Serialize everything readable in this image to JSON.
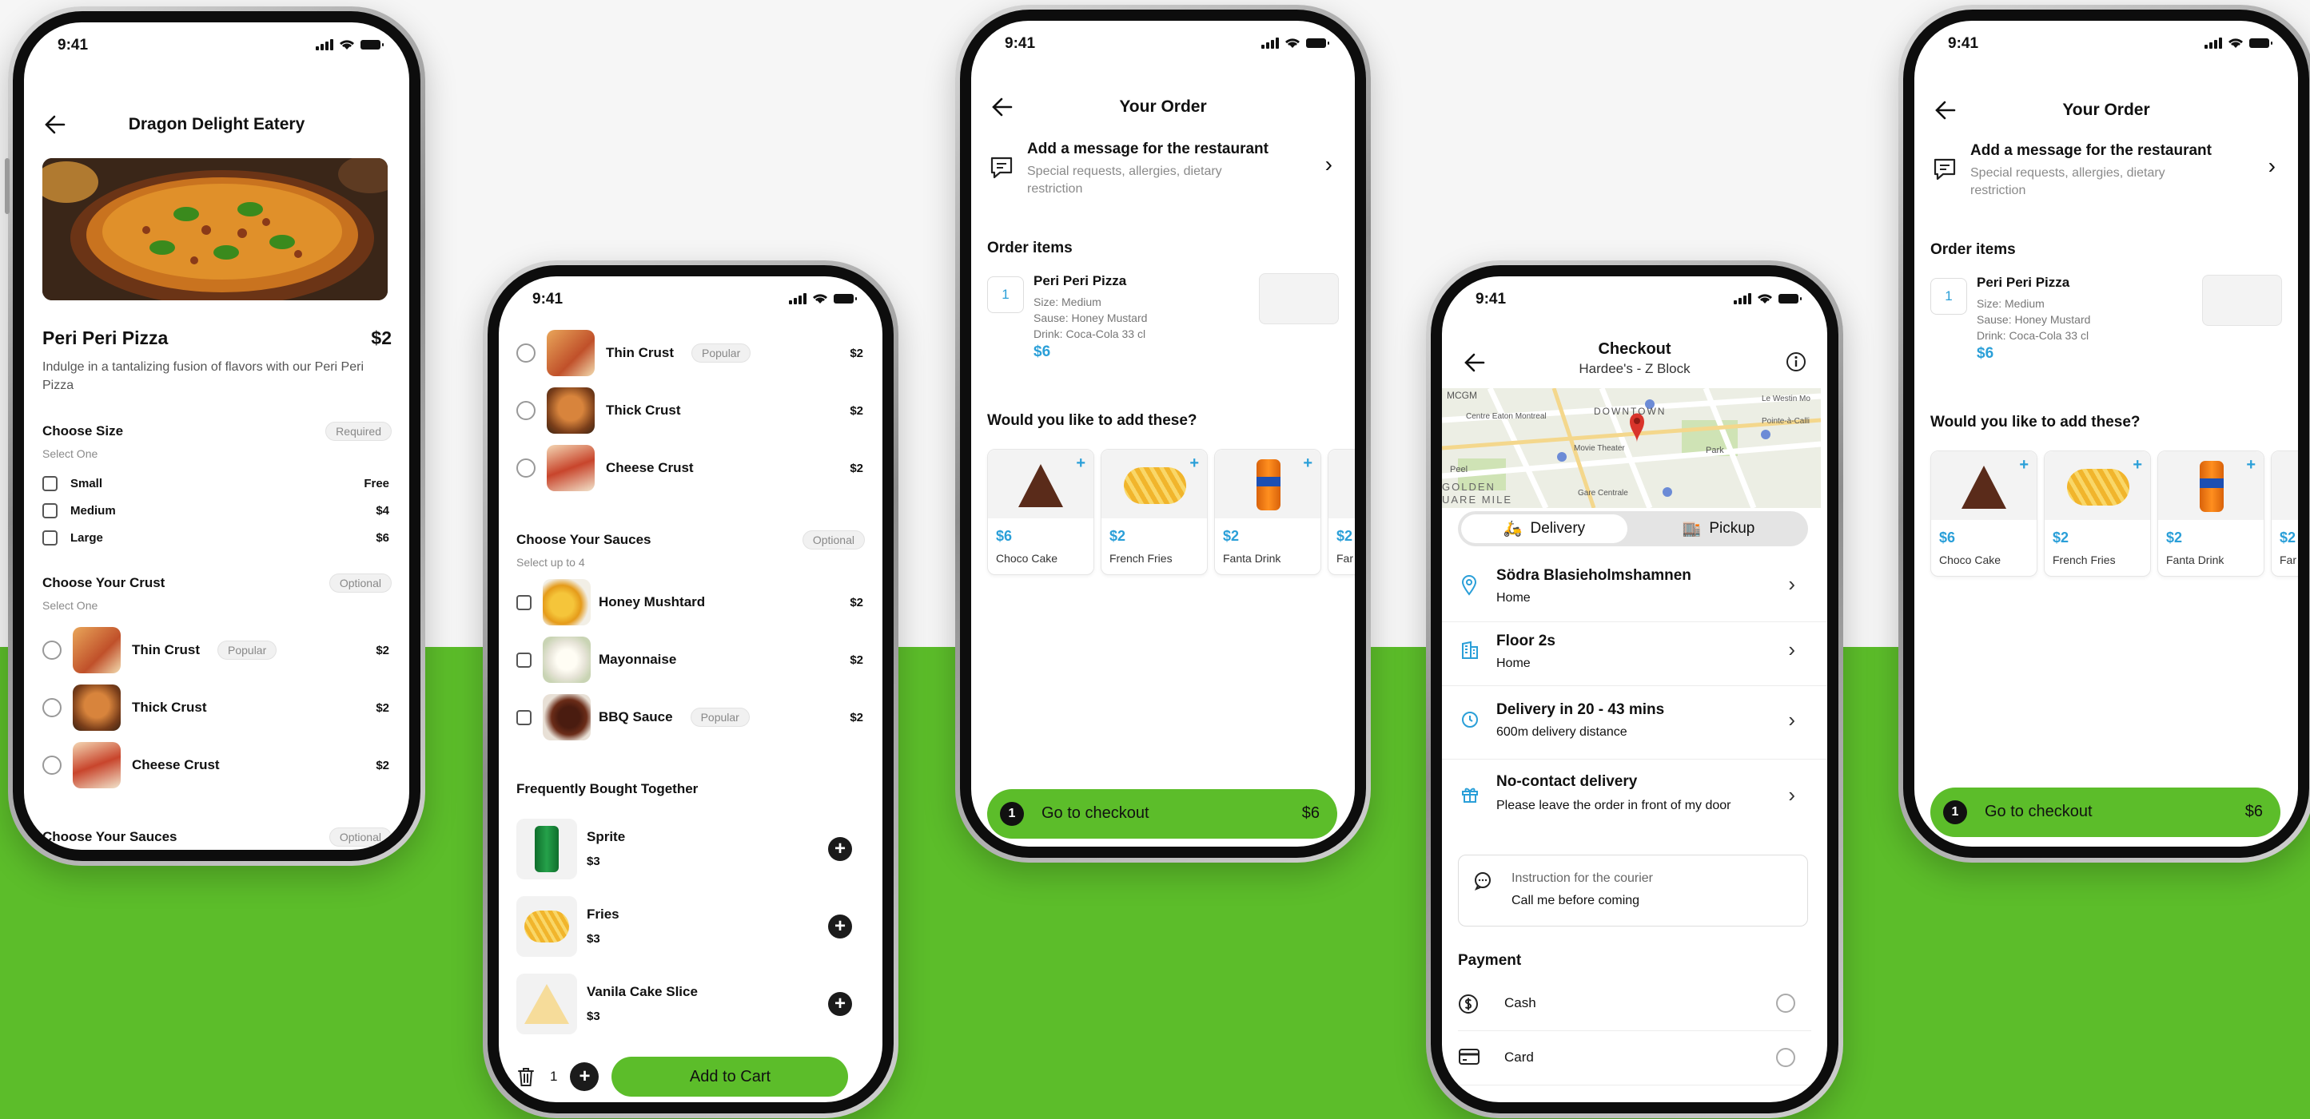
{
  "status": {
    "time": "9:41"
  },
  "p1": {
    "title": "Dragon Delight Eatery",
    "item_name": "Peri Peri Pizza",
    "item_price": "$2",
    "description": "Indulge in a tantalizing fusion of flavors with our Peri Peri Pizza",
    "size": {
      "title": "Choose Size",
      "badge": "Required",
      "sub": "Select One",
      "options": [
        {
          "label": "Small",
          "price": "Free"
        },
        {
          "label": "Medium",
          "price": "$4"
        },
        {
          "label": "Large",
          "price": "$6"
        }
      ]
    },
    "crust": {
      "title": "Choose Your Crust",
      "badge": "Optional",
      "sub": "Select One",
      "options": [
        {
          "label": "Thin Crust",
          "tag": "Popular",
          "price": "$2"
        },
        {
          "label": "Thick Crust",
          "price": "$2"
        },
        {
          "label": "Cheese Crust",
          "price": "$2"
        }
      ]
    },
    "sauces": {
      "title": "Choose Your Sauces",
      "badge": "Optional"
    }
  },
  "p2": {
    "crusts": [
      {
        "label": "Thin Crust",
        "tag": "Popular",
        "price": "$2"
      },
      {
        "label": "Thick Crust",
        "price": "$2"
      },
      {
        "label": "Cheese Crust",
        "price": "$2"
      }
    ],
    "sauces": {
      "title": "Choose Your Sauces",
      "badge": "Optional",
      "sub": "Select up to 4",
      "options": [
        {
          "label": "Honey Mushtard",
          "price": "$2"
        },
        {
          "label": "Mayonnaise",
          "price": "$2"
        },
        {
          "label": "BBQ Sauce",
          "tag": "Popular",
          "price": "$2"
        }
      ]
    },
    "fbt": {
      "title": "Frequently Bought Together",
      "items": [
        {
          "name": "Sprite",
          "price": "$3"
        },
        {
          "name": "Fries",
          "price": "$3"
        },
        {
          "name": "Vanila Cake Slice",
          "price": "$3"
        }
      ]
    },
    "qty": "1",
    "add_label": "Add to Cart"
  },
  "order": {
    "title": "Your Order",
    "message_title": "Add a message for the restaurant",
    "message_sub": "Special requests, allergies, dietary restriction",
    "items_title": "Order items",
    "item": {
      "qty": "1",
      "name": "Peri Peri Pizza",
      "size": "Size: Medium",
      "sauce": "Sause: Honey Mustard",
      "drink": "Drink: Coca-Cola 33 cl",
      "price": "$6"
    },
    "addons_title": "Would you like to add these?",
    "addons": [
      {
        "price": "$6",
        "name": "Choco Cake"
      },
      {
        "price": "$2",
        "name": "French Fries"
      },
      {
        "price": "$2",
        "name": "Fanta Drink"
      },
      {
        "price": "$2",
        "name": "Far"
      }
    ],
    "checkout": {
      "count": "1",
      "label": "Go to checkout",
      "price": "$6"
    }
  },
  "checkout": {
    "title": "Checkout",
    "subtitle": "Hardee's - Z Block",
    "map_labels": [
      "DOWNTOWN",
      "Centre Eaton Montreal",
      "Movie Theater",
      "Peel",
      "Gare Centrale",
      "GOLDEN",
      "UARE MILE",
      "Le Westin Mo",
      "Park",
      "Pointe-à-Calli",
      "MCGM"
    ],
    "tabs": [
      "Delivery",
      "Pickup"
    ],
    "rows": [
      {
        "title": "Södra Blasieholmshamnen",
        "sub": "Home"
      },
      {
        "title": "Floor 2s",
        "sub": "Home"
      },
      {
        "title": "Delivery in 20 - 43 mins",
        "sub": "600m delivery distance"
      },
      {
        "title": "No-contact delivery",
        "sub": "Please leave the order in front of my door"
      }
    ],
    "instruction_label": "Instruction for the courier",
    "instruction_value": "Call me before coming",
    "payment_title": "Payment",
    "payments": [
      "Cash",
      "Card"
    ]
  },
  "colors": {
    "green": "#5cbd2a",
    "blue": "#2a9fd8",
    "dark": "#111111"
  }
}
